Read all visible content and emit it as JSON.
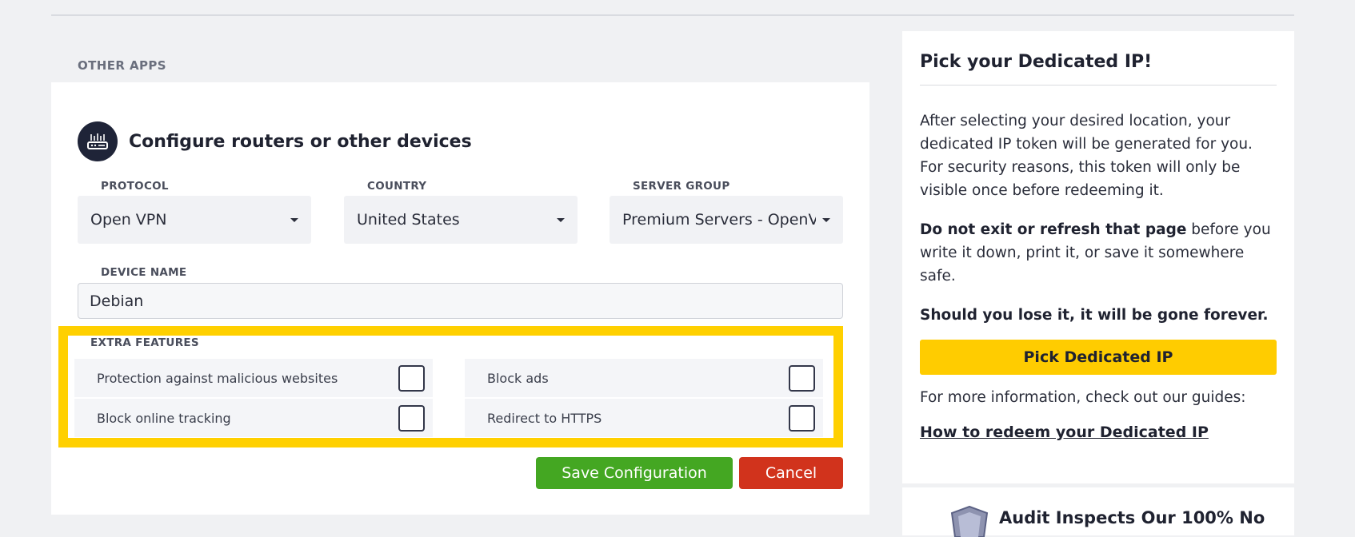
{
  "section": {
    "heading": "OTHER APPS"
  },
  "config": {
    "title": "Configure routers or other devices",
    "icon": "router-icon",
    "protocol": {
      "label": "PROTOCOL",
      "value": "Open VPN"
    },
    "country": {
      "label": "COUNTRY",
      "value": "United States"
    },
    "server_group": {
      "label": "SERVER GROUP",
      "value": "Premium Servers - OpenVPN"
    },
    "device": {
      "label": "DEVICE NAME",
      "value": "Debian"
    },
    "extra_features": {
      "label": "EXTRA FEATURES",
      "items": [
        {
          "label": "Protection against malicious websites",
          "checked": false
        },
        {
          "label": "Block ads",
          "checked": false
        },
        {
          "label": "Block online tracking",
          "checked": false
        },
        {
          "label": "Redirect to HTTPS",
          "checked": false
        }
      ]
    },
    "save_label": "Save Configuration",
    "cancel_label": "Cancel"
  },
  "sidebar": {
    "title": "Pick your Dedicated IP!",
    "para1": "After selecting your desired location, your dedicated IP token will be generated for you. For security reasons, this token will only be visible once before redeeming it.",
    "para2_bold": "Do not exit or refresh that page",
    "para2_rest": " before you write it down, print it, or save it somewhere safe.",
    "para3": "Should you lose it, it will be gone forever.",
    "button_label": "Pick Dedicated IP",
    "para4": "For more information, check out our guides:",
    "link_label": "How to redeem your Dedicated IP"
  },
  "audit": {
    "text": "Audit Inspects Our 100% ",
    "text_bold": "No",
    "icon": "shield-icon"
  },
  "colors": {
    "highlight": "#ffd000",
    "save": "#44a722",
    "cancel": "#d1331c",
    "primary_button": "#ffcc00",
    "icon_bg": "#1f2438"
  }
}
